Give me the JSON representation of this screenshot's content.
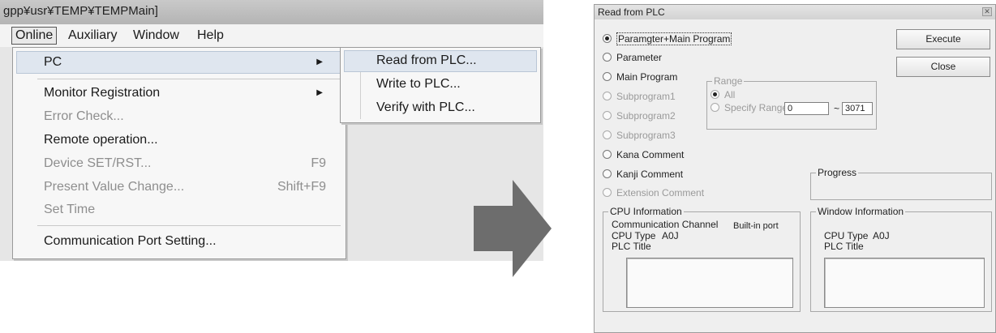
{
  "menu_screenshot": {
    "title_path": "gpp¥usr¥TEMP¥TEMPMain]",
    "menubar": [
      "Online",
      "Auxiliary",
      "Window",
      "Help"
    ],
    "online_menu": {
      "pc": "PC",
      "monitor_registration": "Monitor Registration",
      "error_check": "Error Check...",
      "remote_operation": "Remote operation...",
      "device_set_rst": "Device SET/RST...",
      "device_set_rst_shortcut": "F9",
      "present_value_change": "Present Value Change...",
      "present_value_change_shortcut": "Shift+F9",
      "set_time": "Set Time",
      "communication_port_setting": "Communication Port Setting..."
    },
    "pc_submenu": [
      "Read from PLC...",
      "Write to PLC...",
      "Verify with PLC..."
    ]
  },
  "dialog": {
    "title": "Read from PLC",
    "options": {
      "param_main": "Paramgter+Main Program",
      "parameter": "Parameter",
      "main_program": "Main Program",
      "subprogram1": "Subprogram1",
      "subprogram2": "Subprogram2",
      "subprogram3": "Subprogram3",
      "kana_comment": "Kana Comment",
      "kanji_comment": "Kanji Comment",
      "extension_comment": "Extension Comment"
    },
    "buttons": {
      "execute": "Execute",
      "close": "Close"
    },
    "range": {
      "legend": "Range",
      "all": "All",
      "specify": "Specify Range",
      "from": "0",
      "separator": "~",
      "to": "3071"
    },
    "progress": {
      "legend": "Progress"
    },
    "cpu_info": {
      "legend": "CPU Information",
      "comm_channel_label": "Communication Channel",
      "comm_channel_value": "Built-in port",
      "cpu_type_label": "CPU Type",
      "cpu_type_value": "A0J",
      "plc_title_label": "PLC Title"
    },
    "window_info": {
      "legend": "Window Information",
      "cpu_type_label": "CPU Type",
      "cpu_type_value": "A0J",
      "plc_title_label": "PLC Title"
    }
  }
}
